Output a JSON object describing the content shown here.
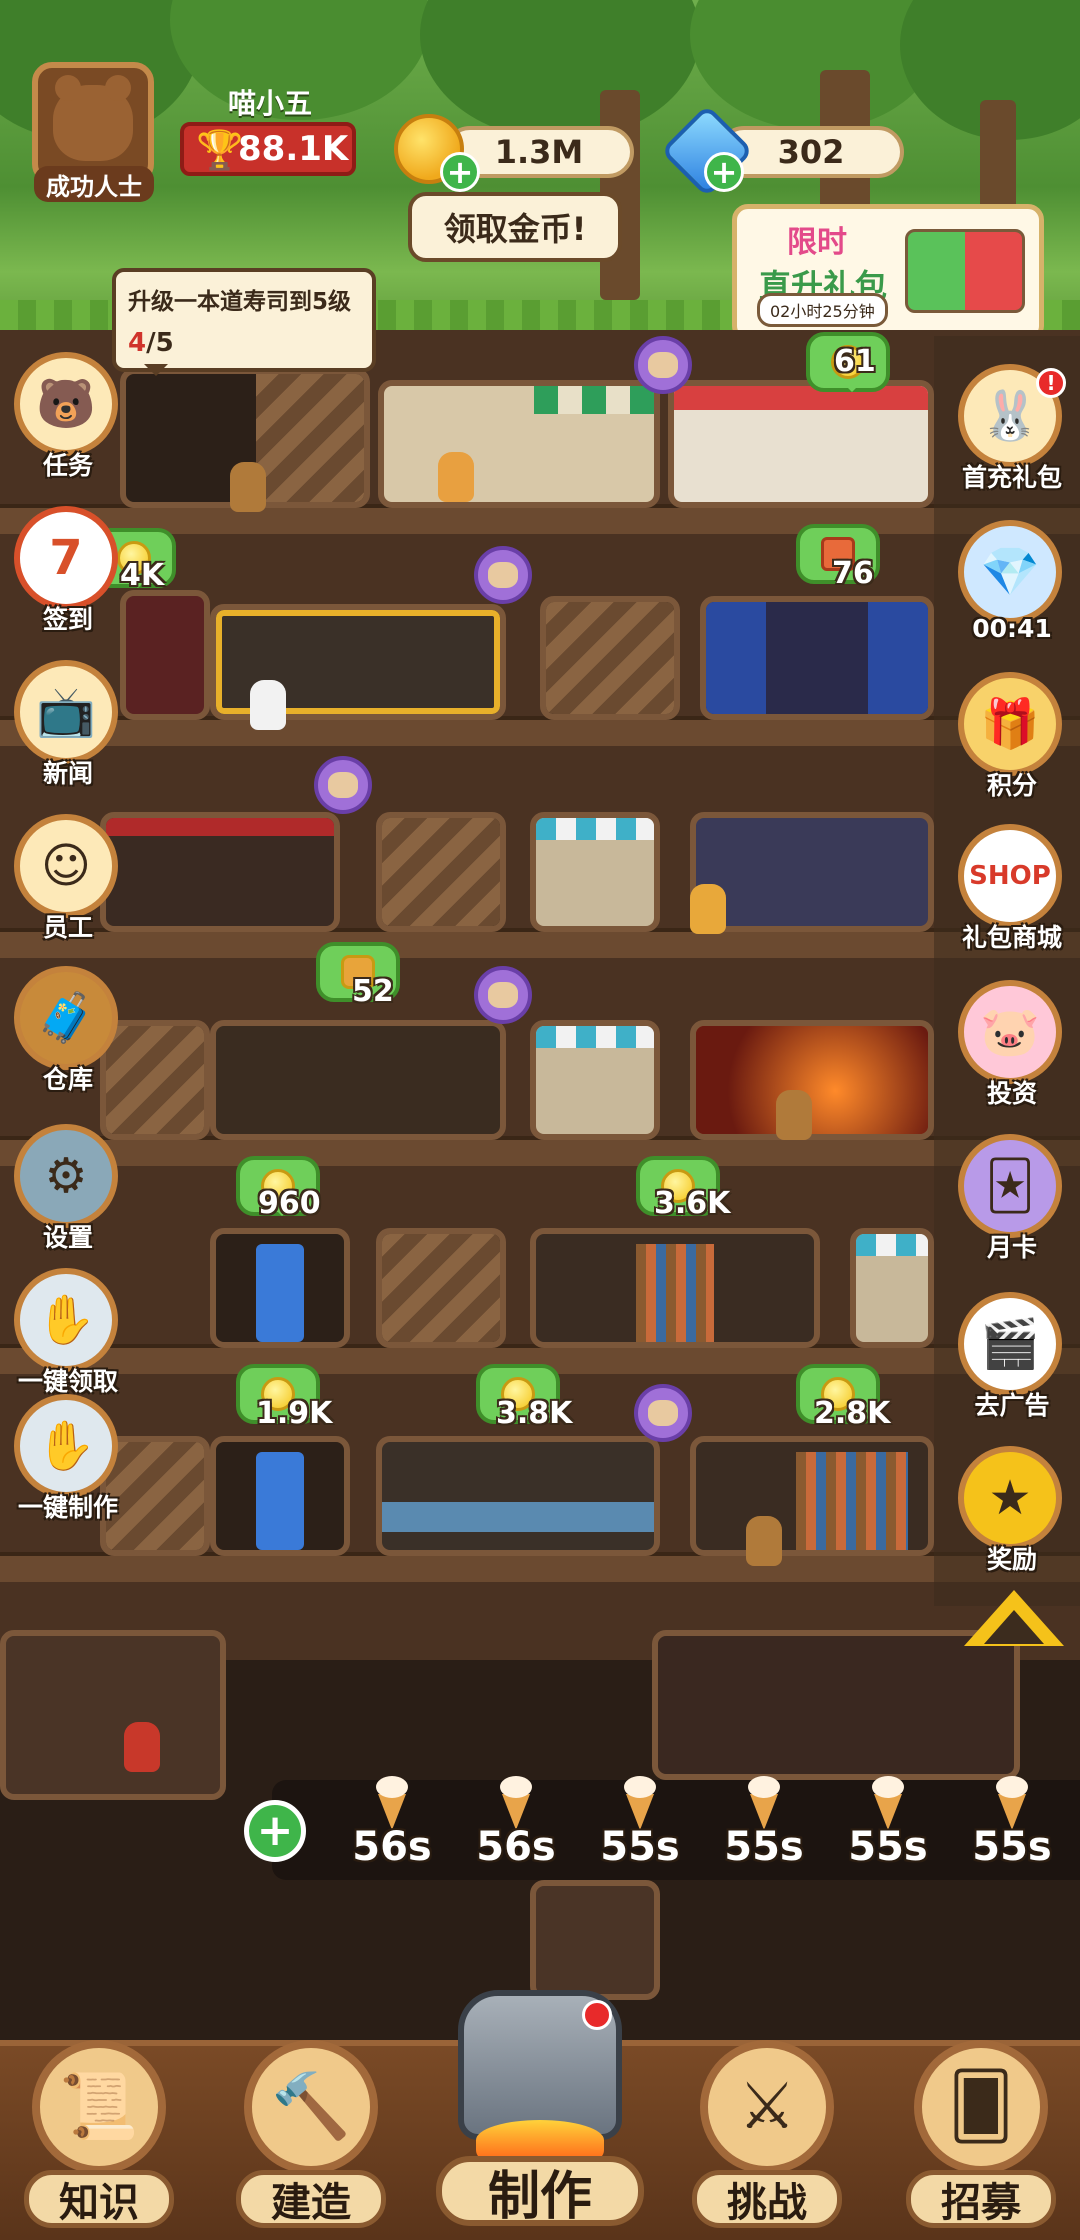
{
  "player": {
    "name": "喵小五",
    "title": "成功人士",
    "trophy": "88.1K"
  },
  "currency": {
    "coins": "1.3M",
    "gems": "302",
    "collect_coins_label": "领取金币!"
  },
  "gift_banner": {
    "line1": "限时",
    "line2": "直升礼包",
    "timer": "02小时25分钟"
  },
  "task": {
    "text": "升级一本道寿司到5级",
    "progress_current": "4",
    "progress_total": "/5"
  },
  "markers": {
    "m1": "61",
    "m2": "4K",
    "m3": "76",
    "m4": "52",
    "m5": "960",
    "m6": "3.6K",
    "m7": "1.9K",
    "m8": "3.8K",
    "m9": "2.8K"
  },
  "left_menu": [
    {
      "label": "任务",
      "icon": "task-icon"
    },
    {
      "label": "签到",
      "icon": "calendar-icon",
      "day": "7"
    },
    {
      "label": "新闻",
      "icon": "news-icon"
    },
    {
      "label": "员工",
      "icon": "staff-icon"
    },
    {
      "label": "仓库",
      "icon": "warehouse-icon"
    },
    {
      "label": "设置",
      "icon": "gear-icon"
    },
    {
      "label": "一键领取",
      "icon": "collect-all-icon"
    },
    {
      "label": "一键制作",
      "icon": "make-all-icon"
    }
  ],
  "right_menu": [
    {
      "label": "首充礼包",
      "icon": "first-charge-icon"
    },
    {
      "label": "00:41",
      "icon": "gem-pile-icon"
    },
    {
      "label": "积分",
      "icon": "points-gift-icon"
    },
    {
      "label": "礼包商城",
      "icon": "shop-icon",
      "sign": "SHOP"
    },
    {
      "label": "投资",
      "icon": "piggy-bank-icon"
    },
    {
      "label": "月卡",
      "icon": "month-card-icon"
    },
    {
      "label": "去广告",
      "icon": "remove-ads-icon"
    },
    {
      "label": "奖励",
      "icon": "reward-star-icon"
    }
  ],
  "cook_queue": [
    "56s",
    "56s",
    "55s",
    "55s",
    "55s",
    "55s"
  ],
  "bottom_nav": {
    "knowledge": "知识",
    "build": "建造",
    "make": "制作",
    "challenge": "挑战",
    "recruit": "招募"
  },
  "colors": {
    "earth": "#4a3222",
    "sky": "#5e9a3a",
    "accent_green": "#3fb54a",
    "accent_red": "#c8312a"
  }
}
